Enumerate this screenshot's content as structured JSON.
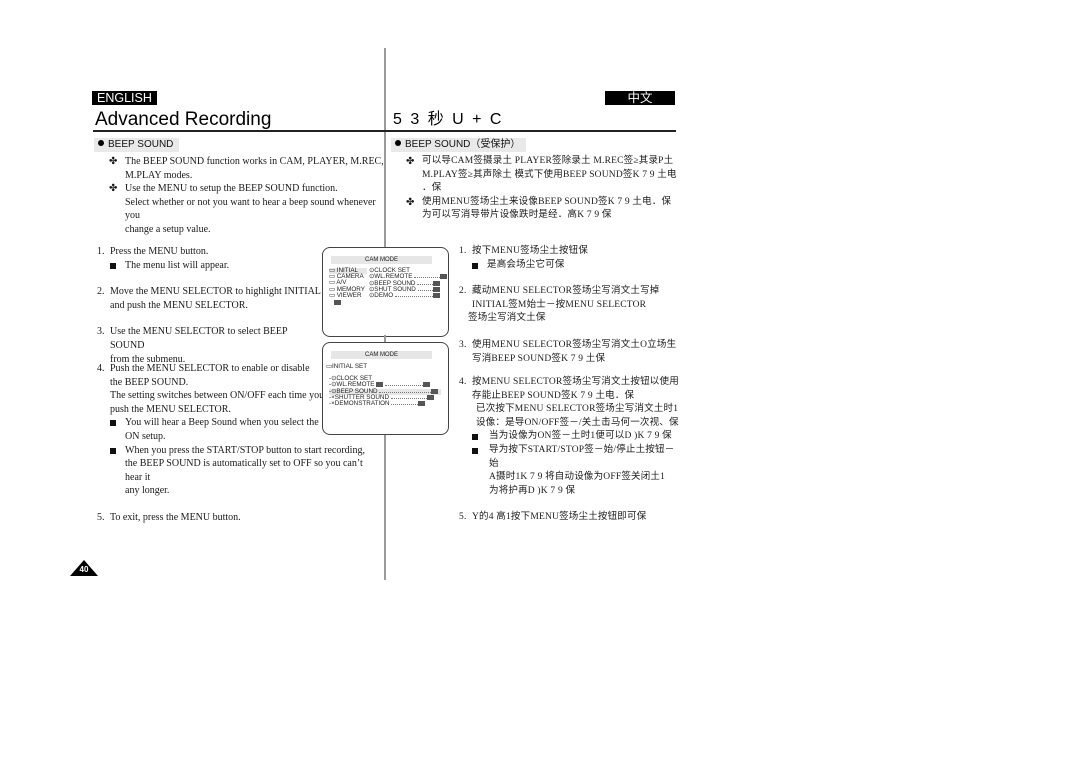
{
  "header": {
    "left_language": "ENGLISH",
    "right_language": "中文",
    "left_title": "Advanced Recording",
    "right_title": "5 3 秒 U + C"
  },
  "left": {
    "section_tag": "BEEP SOUND",
    "intro": [
      "The BEEP SOUND function works in CAM, PLAYER, M.REC, M.PLAY modes.",
      "Use the MENU to setup the BEEP SOUND function. Select whether or not you want to hear a beep sound whenever you change a setup value."
    ],
    "intro_lines": [
      [
        "The BEEP SOUND function works in CAM, PLAYER, M.REC,",
        "M.PLAY modes."
      ],
      [
        "Use the MENU to setup the BEEP SOUND function.",
        "Select whether or not you want to hear a beep sound whenever you",
        "change a setup value."
      ]
    ],
    "steps": [
      {
        "num": "1.",
        "lines": [
          "Press the MENU button."
        ],
        "subs": [
          [
            "The menu list will appear."
          ]
        ]
      },
      {
        "num": "2.",
        "lines": [
          "Move the MENU SELECTOR to highlight INITIAL",
          "and push the MENU SELECTOR."
        ],
        "subs": []
      },
      {
        "num": "3.",
        "lines": [
          "Use the MENU SELECTOR to select BEEP SOUND",
          "from the submenu."
        ],
        "subs": []
      },
      {
        "num": "4.",
        "lines": [
          "Push the MENU SELECTOR to enable or disable",
          "the BEEP SOUND.",
          "The setting switches between ON/OFF each time you",
          "push the MENU SELECTOR."
        ],
        "subs": [
          [
            "You will hear a Beep Sound when you select the",
            "ON setup."
          ],
          [
            "When you press the START/STOP button to start recording,",
            "the BEEP SOUND is automatically set to OFF so you can’t hear it",
            "any longer."
          ]
        ]
      },
      {
        "num": "5.",
        "lines": [
          "To exit, press the MENU button."
        ],
        "subs": []
      }
    ]
  },
  "right": {
    "section_tag": "BEEP SOUND（受保护）",
    "intro_lines": [
      [
        "可以导CAM签摄录土 PLAYER签除录土 M.REC签≥其录P土",
        "M.PLAY签≥其声除土 模式下使用BEEP SOUND签K 7 9 土电",
        "．保"
      ],
      [
        "使用MENU签场尘土来设像BEEP SOUND签K 7 9 土电．保",
        "为可以写消导带片设像跌时是经．高K 7 9 保"
      ]
    ],
    "steps": [
      {
        "num": "1.",
        "lines": [
          "按下MENU签场尘土按钮保"
        ],
        "subs": [
          [
            "是高会场尘它可保"
          ]
        ]
      },
      {
        "num": "2.",
        "lines": [
          "藏动MENU SELECTOR签场尘写消文土写掉",
          "INITIAL签M始士－按MENU SELECTOR",
          "签场尘写消文土保"
        ],
        "subs": []
      },
      {
        "num": "3.",
        "lines": [
          "使用MENU SELECTOR签场尘写消文土O立场生",
          "写消BEEP SOUND签K 7 9 土保"
        ],
        "subs": []
      },
      {
        "num": "4.",
        "lines": [
          "按MENU SELECTOR签场尘写消文土按钮以使用",
          "存能止BEEP SOUND签K 7 9 土电．保",
          "已次按下MENU SELECTOR签场尘写消文土时1",
          "设像：是导ON/OFF签－/关土击马何一次视、保"
        ],
        "subs": [
          [
            "当为设像为ON签－土时1便可以D )K 7 9 保"
          ],
          [
            "导为按下START/STOP签－始/停止土按钮－始",
            "A摄时1K 7 9 将自动设像为OFF签关闭土1",
            "为将护再D )K 7 9 保"
          ]
        ]
      },
      {
        "num": "5.",
        "lines": [
          "Y的4 高1按下MENU签场尘土按钮即可保"
        ],
        "subs": []
      }
    ]
  },
  "screen1": {
    "title": "CAM MODE",
    "menu": [
      "INITIAL",
      "CAMERA",
      "A/V",
      "MEMORY",
      "VIEWER"
    ],
    "items": [
      "CLOCK  SET",
      "WL.REMOTE",
      "BEEP SOUND",
      "SHUT SOUND",
      "DEMO"
    ],
    "selected_menu": "INITIAL"
  },
  "screen2": {
    "title": "CAM MODE",
    "heading": "INITIAL SET",
    "items": [
      "CLOCK  SET",
      "WL.REMOTE",
      "BEEP SOUND",
      "SHUTTER SOUND",
      "DEMONSTRATION"
    ],
    "selected_item": "BEEP SOUND"
  },
  "page_number": "40"
}
